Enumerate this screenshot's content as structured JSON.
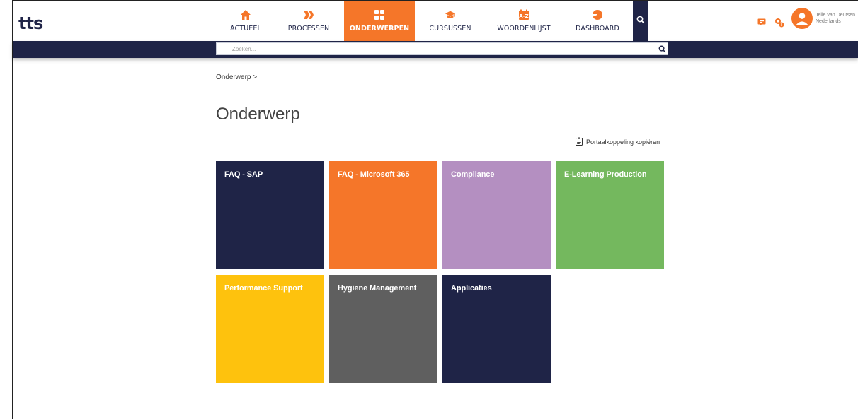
{
  "app": {
    "logo": "tts"
  },
  "nav": {
    "items": [
      {
        "label": "ACTUEEL",
        "icon": "home-icon"
      },
      {
        "label": "PROCESSEN",
        "icon": "process-chevrons-icon"
      },
      {
        "label": "ONDERWERPEN",
        "icon": "grid-icon",
        "active": true
      },
      {
        "label": "CURSUSSEN",
        "icon": "graduation-cap-icon"
      },
      {
        "label": "WOORDENLIJST",
        "icon": "glossary-az-icon"
      },
      {
        "label": "DASHBOARD",
        "icon": "pie-chart-icon"
      }
    ],
    "search_icon": "search-icon"
  },
  "user": {
    "name": "Jelle van Deursen",
    "language": "Nederlands"
  },
  "search": {
    "placeholder": "Zoeken..."
  },
  "breadcrumb": "Onderwerp  >",
  "page_title": "Onderwerp",
  "portal_link": {
    "label": "Portaalkoppeling kopiëren",
    "icon": "clipboard-icon"
  },
  "tiles": [
    {
      "label": "FAQ - SAP",
      "color": "#1f2447"
    },
    {
      "label": "FAQ - Microsoft 365",
      "color": "#f57629"
    },
    {
      "label": "Compliance",
      "color": "#b48fc1"
    },
    {
      "label": "E-Learning Production",
      "color": "#74b85e"
    },
    {
      "label": "Performance Support",
      "color": "#fec20d"
    },
    {
      "label": "Hygiene Management",
      "color": "#5f5f5f"
    },
    {
      "label": "Applicaties",
      "color": "#1f2447"
    }
  ],
  "colors": {
    "accent": "#f57629",
    "navy": "#1f2447"
  }
}
